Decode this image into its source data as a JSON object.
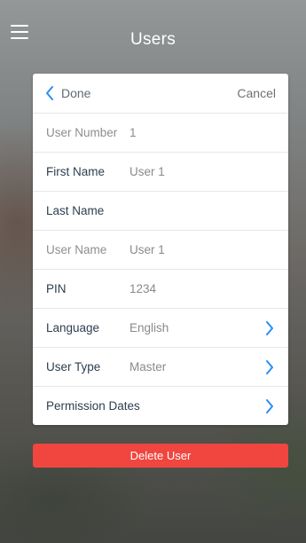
{
  "header": {
    "title": "Users"
  },
  "card": {
    "done_label": "Done",
    "cancel_label": "Cancel",
    "rows": [
      {
        "label": "User Number",
        "value": "1",
        "editable": false
      },
      {
        "label": "First Name",
        "value": "User 1",
        "editable": true
      },
      {
        "label": "Last Name",
        "value": "",
        "editable": true
      },
      {
        "label": "User Name",
        "value": "User 1",
        "editable": false
      },
      {
        "label": "PIN",
        "value": "1234",
        "editable": true
      },
      {
        "label": "Language",
        "value": "English",
        "editable": true
      },
      {
        "label": "User Type",
        "value": "Master",
        "editable": true
      },
      {
        "label": "Permission Dates",
        "value": "",
        "editable": true
      }
    ]
  },
  "delete_button": {
    "label": "Delete User"
  },
  "colors": {
    "accent": "#2b8ef0",
    "danger": "#f0463f"
  },
  "icons": {
    "menu": "hamburger-icon",
    "back": "chevron-left-icon",
    "next": "chevron-right-icon"
  }
}
